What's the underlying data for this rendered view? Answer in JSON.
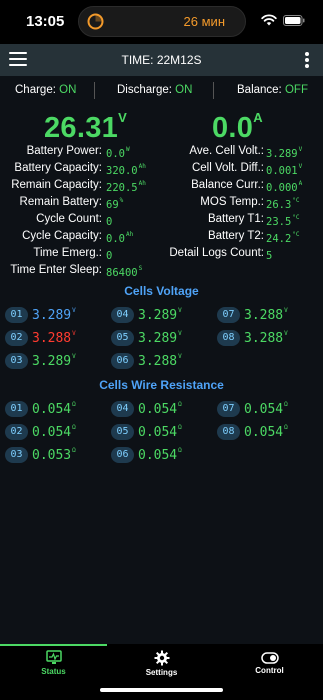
{
  "status_bar": {
    "time": "13:05",
    "timer_text": "26 мин"
  },
  "header": {
    "title": "TIME: 22M12S"
  },
  "toggles": {
    "charge": {
      "label": "Charge:",
      "value": "ON"
    },
    "discharge": {
      "label": "Discharge:",
      "value": "ON"
    },
    "balance": {
      "label": "Balance:",
      "value": "OFF"
    }
  },
  "summary": {
    "voltage": {
      "value": "26.31",
      "unit": "V"
    },
    "current": {
      "value": "0.0",
      "unit": "A"
    }
  },
  "left_stats": [
    {
      "label": "Battery Power:",
      "value": "0.0",
      "unit": "W"
    },
    {
      "label": "Battery Capacity:",
      "value": "320.0",
      "unit": "Ah"
    },
    {
      "label": "Remain Capacity:",
      "value": "220.5",
      "unit": "Ah"
    },
    {
      "label": "Remain Battery:",
      "value": "69",
      "unit": "%"
    },
    {
      "label": "Cycle Count:",
      "value": "0",
      "unit": ""
    },
    {
      "label": "Cycle Capacity:",
      "value": "0.0",
      "unit": "Ah"
    },
    {
      "label": "Time Emerg.:",
      "value": "0",
      "unit": ""
    },
    {
      "label": "Time Enter Sleep:",
      "value": "86400",
      "unit": "S"
    }
  ],
  "right_stats": [
    {
      "label": "Ave. Cell Volt.:",
      "value": "3.289",
      "unit": "V"
    },
    {
      "label": "Cell Volt. Diff.:",
      "value": "0.001",
      "unit": "V"
    },
    {
      "label": "Balance Curr.:",
      "value": "0.000",
      "unit": "A"
    },
    {
      "label": "MOS Temp.:",
      "value": "26.3",
      "unit": "°C"
    },
    {
      "label": "Battery T1:",
      "value": "23.5",
      "unit": "°C"
    },
    {
      "label": "Battery T2:",
      "value": "24.2",
      "unit": "°C"
    },
    {
      "label": "Detail Logs Count:",
      "value": "5",
      "unit": ""
    }
  ],
  "cells_voltage": {
    "title": "Cells Voltage",
    "unit": "V",
    "cells": [
      {
        "id": "01",
        "value": "3.289",
        "state": "max"
      },
      {
        "id": "02",
        "value": "3.288",
        "state": "min"
      },
      {
        "id": "03",
        "value": "3.289",
        "state": "normal"
      },
      {
        "id": "04",
        "value": "3.289",
        "state": "normal"
      },
      {
        "id": "05",
        "value": "3.289",
        "state": "normal"
      },
      {
        "id": "06",
        "value": "3.288",
        "state": "normal"
      },
      {
        "id": "07",
        "value": "3.288",
        "state": "normal"
      },
      {
        "id": "08",
        "value": "3.288",
        "state": "normal"
      }
    ]
  },
  "cells_resistance": {
    "title": "Cells Wire Resistance",
    "unit": "Ω",
    "cells": [
      {
        "id": "01",
        "value": "0.054"
      },
      {
        "id": "02",
        "value": "0.054"
      },
      {
        "id": "03",
        "value": "0.053"
      },
      {
        "id": "04",
        "value": "0.054"
      },
      {
        "id": "05",
        "value": "0.054"
      },
      {
        "id": "06",
        "value": "0.054"
      },
      {
        "id": "07",
        "value": "0.054"
      },
      {
        "id": "08",
        "value": "0.054"
      }
    ]
  },
  "tabs": [
    {
      "label": "Status",
      "icon": "status-monitor-icon",
      "active": true
    },
    {
      "label": "Settings",
      "icon": "gear-icon",
      "active": false
    },
    {
      "label": "Control",
      "icon": "toggle-icon",
      "active": false
    }
  ],
  "colors": {
    "accent_green": "#4cd964",
    "section_blue": "#4fa3f7",
    "max_cell_blue": "#4fa3f7",
    "min_cell_red": "#ff3b30",
    "header_bg": "#263238",
    "timer_orange": "#f39a2b"
  }
}
